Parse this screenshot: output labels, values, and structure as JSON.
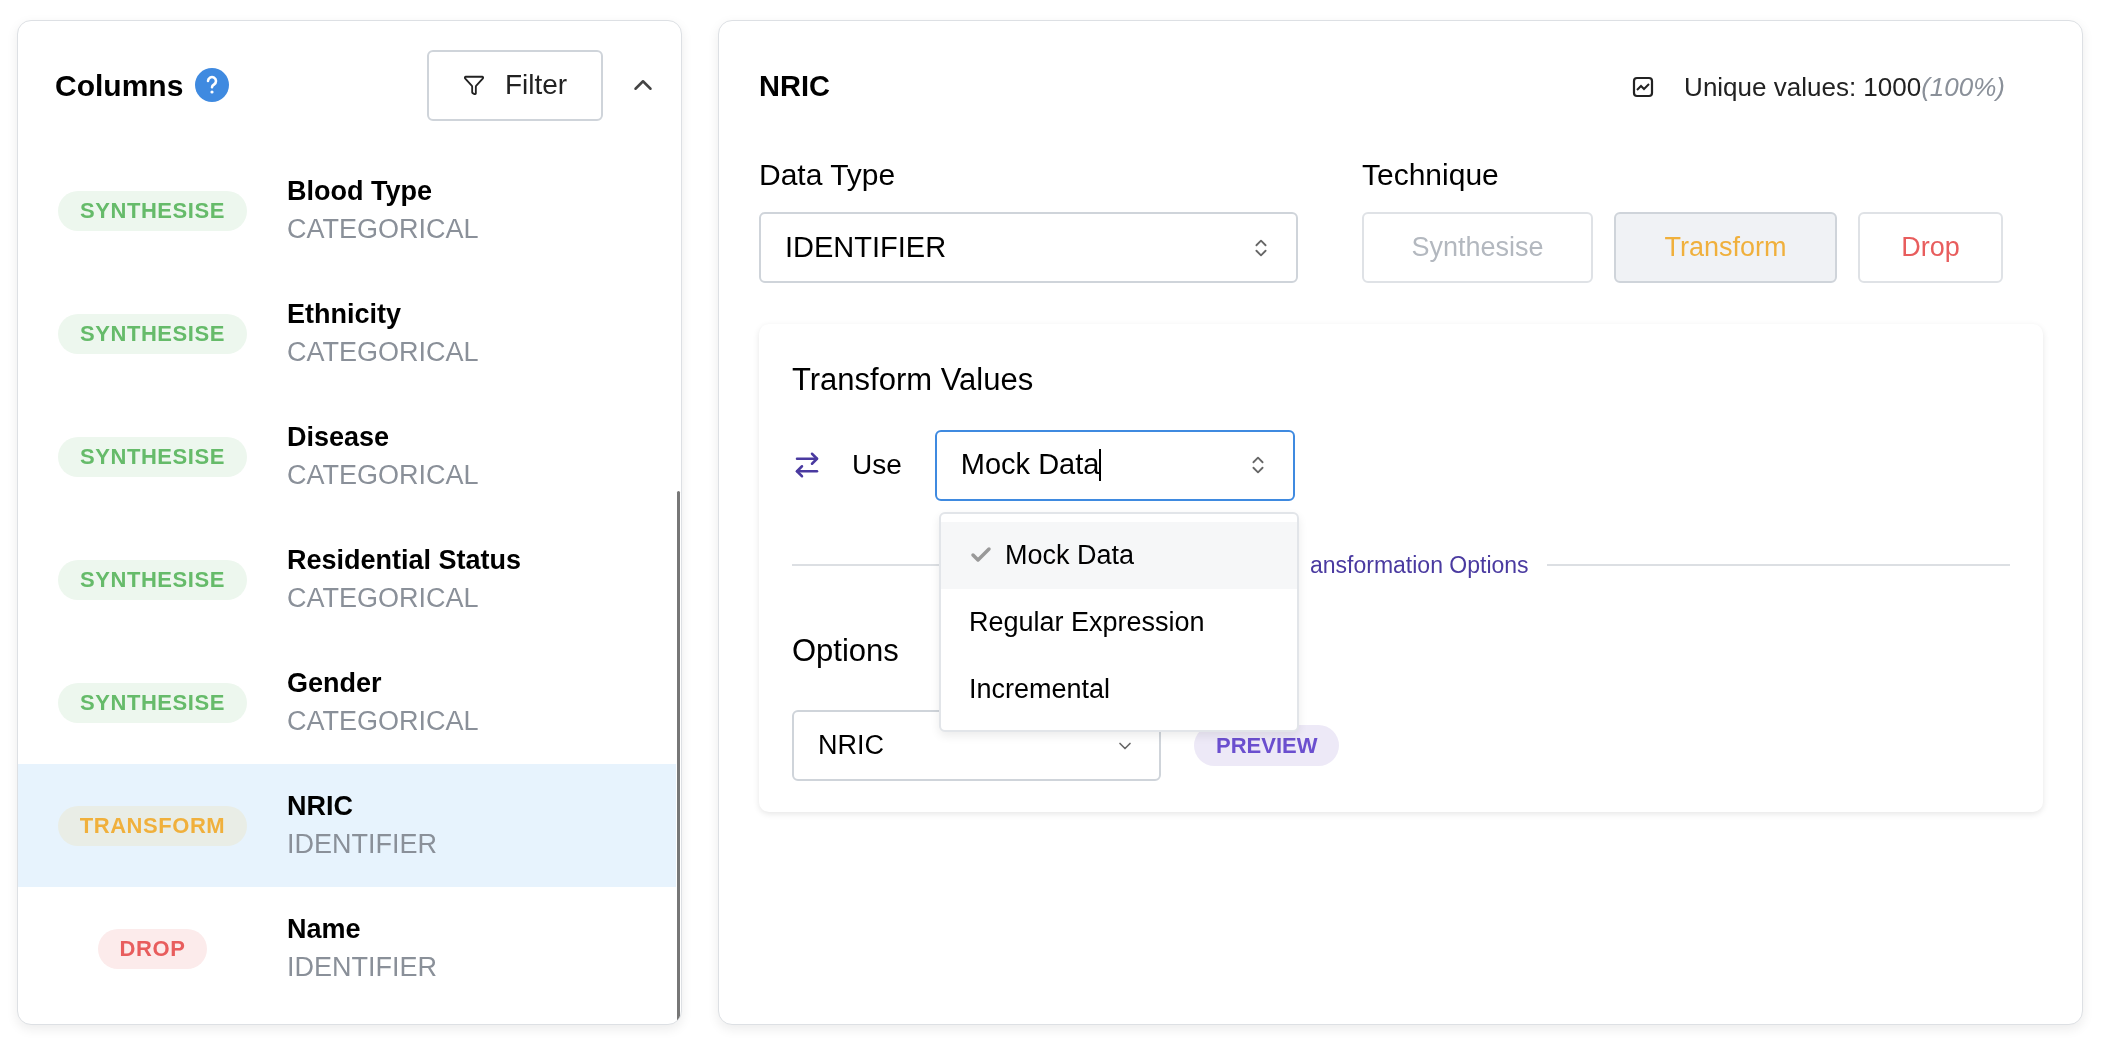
{
  "columns_panel": {
    "title": "Columns",
    "filter_button": "Filter",
    "expanded": true,
    "items": [
      {
        "technique": "SYNTHESISE",
        "kind": "synthesise",
        "name": "Blood Type",
        "type": "CATEGORICAL",
        "selected": false
      },
      {
        "technique": "SYNTHESISE",
        "kind": "synthesise",
        "name": "Ethnicity",
        "type": "CATEGORICAL",
        "selected": false
      },
      {
        "technique": "SYNTHESISE",
        "kind": "synthesise",
        "name": "Disease",
        "type": "CATEGORICAL",
        "selected": false
      },
      {
        "technique": "SYNTHESISE",
        "kind": "synthesise",
        "name": "Residential Status",
        "type": "CATEGORICAL",
        "selected": false
      },
      {
        "technique": "SYNTHESISE",
        "kind": "synthesise",
        "name": "Gender",
        "type": "CATEGORICAL",
        "selected": false
      },
      {
        "technique": "TRANSFORM",
        "kind": "transform",
        "name": "NRIC",
        "type": "IDENTIFIER",
        "selected": true
      },
      {
        "technique": "DROP",
        "kind": "drop",
        "name": "Name",
        "type": "IDENTIFIER",
        "selected": false
      }
    ]
  },
  "detail": {
    "title": "NRIC",
    "unique_values": "Unique values: 1000",
    "unique_percent": "(100%)",
    "data_type": {
      "label": "Data Type",
      "value": "IDENTIFIER"
    },
    "technique": {
      "label": "Technique",
      "options": [
        {
          "label": "Synthesise",
          "kind": "synthesise",
          "selected": false,
          "disabled": true
        },
        {
          "label": "Transform",
          "kind": "transform",
          "selected": true,
          "disabled": false
        },
        {
          "label": "Drop",
          "kind": "drop",
          "selected": false,
          "disabled": false
        }
      ]
    },
    "transform": {
      "title": "Transform Values",
      "use_label": "Use",
      "value": "Mock Data",
      "divider_text": "ansformation Options",
      "options_title": "Options",
      "options_value": "NRIC",
      "preview_badge": "PREVIEW",
      "dropdown": [
        {
          "label": "Mock Data",
          "selected": true
        },
        {
          "label": "Regular Expression",
          "selected": false
        },
        {
          "label": "Incremental",
          "selected": false
        }
      ]
    }
  }
}
